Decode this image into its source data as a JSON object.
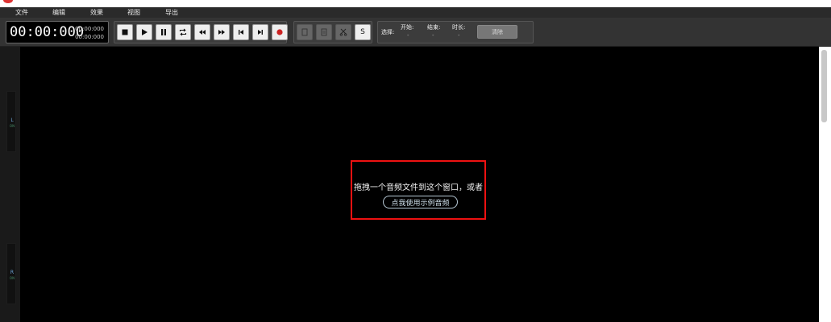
{
  "menu": {
    "file": "文件",
    "edit": "编辑",
    "effects": "效果",
    "view": "视图",
    "export": "导出"
  },
  "time": {
    "main": "00:00:000",
    "current": "00:00:000",
    "total": "00:00:000"
  },
  "transport": {
    "icons": [
      "stop-icon",
      "play-icon",
      "pause-icon",
      "loop-icon",
      "rewind-icon",
      "fast-forward-icon",
      "skip-back-icon",
      "skip-forward-icon",
      "record-icon"
    ]
  },
  "edit_tools": {
    "icons": [
      "copy-icon",
      "paste-icon",
      "cut-icon"
    ],
    "s_label": "S"
  },
  "selection": {
    "label": "选择:",
    "start_label": "开始:",
    "start_value": "-",
    "end_label": "结束:",
    "end_value": "-",
    "duration_label": "时长:",
    "duration_value": "-",
    "clear_label": "清除"
  },
  "meters": {
    "left": {
      "channel": "L",
      "state": "ON"
    },
    "right": {
      "channel": "R",
      "state": "ON"
    }
  },
  "drop": {
    "message": "拖拽一个音频文件到这个窗口，或者",
    "demo_link": "点我使用示例音频"
  },
  "colors": {
    "accent_record": "#cc2222",
    "drop_border": "#ee1111",
    "background": "#000000"
  }
}
